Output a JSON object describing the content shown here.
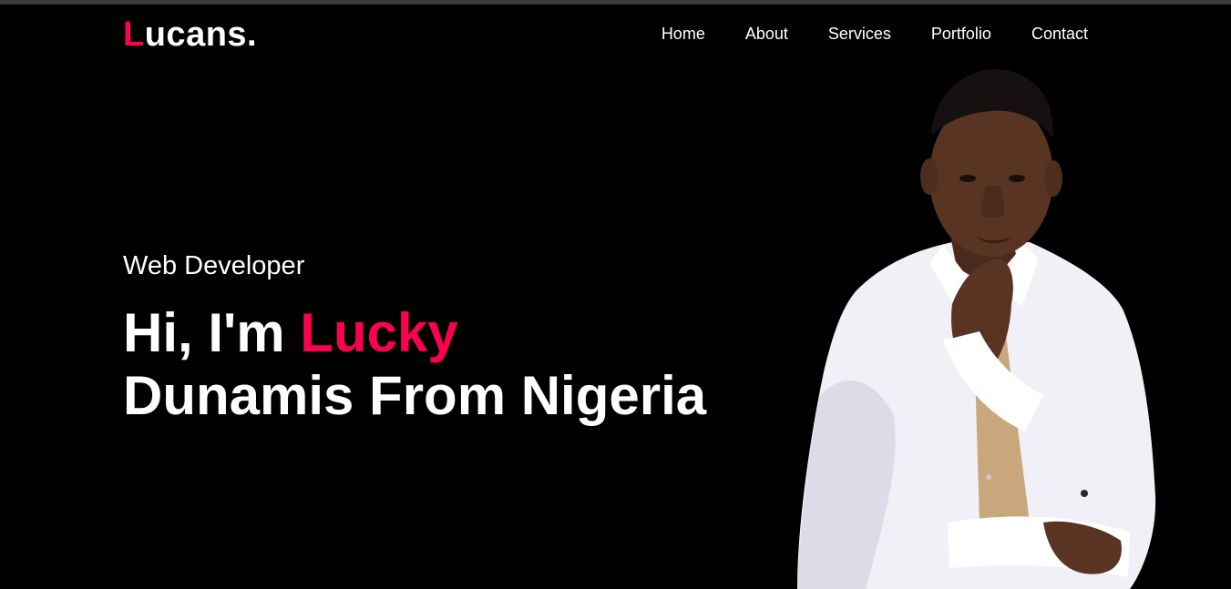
{
  "brand": {
    "first_letter": "L",
    "rest": "ucans.",
    "accent_color": "#ff004f"
  },
  "nav": {
    "items": [
      {
        "label": "Home"
      },
      {
        "label": "About"
      },
      {
        "label": "Services"
      },
      {
        "label": "Portfolio"
      },
      {
        "label": "Contact"
      }
    ]
  },
  "hero": {
    "role": "Web Developer",
    "greeting": "Hi, I'm ",
    "name_highlight": "Lucky",
    "line2": "Dunamis From Nigeria"
  },
  "colors": {
    "background": "#000000",
    "text": "#ffffff",
    "accent": "#ff004f"
  }
}
